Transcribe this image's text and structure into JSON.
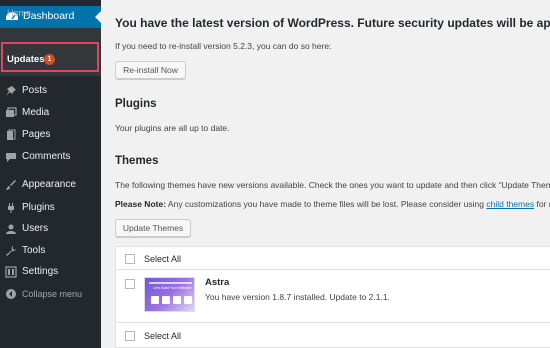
{
  "sidebar": {
    "dashboard_label": "Dashboard",
    "home_label": "Home",
    "updates_label": "Updates",
    "updates_count": "1",
    "items": [
      {
        "label": "Posts",
        "icon": "pin-icon"
      },
      {
        "label": "Media",
        "icon": "media-icon"
      },
      {
        "label": "Pages",
        "icon": "pages-icon"
      },
      {
        "label": "Comments",
        "icon": "comments-icon"
      },
      {
        "label": "Appearance",
        "icon": "brush-icon"
      },
      {
        "label": "Plugins",
        "icon": "plugin-icon"
      },
      {
        "label": "Users",
        "icon": "users-icon"
      },
      {
        "label": "Tools",
        "icon": "wrench-icon"
      },
      {
        "label": "Settings",
        "icon": "settings-icon"
      },
      {
        "label": "Collapse menu",
        "icon": "collapse-icon"
      }
    ]
  },
  "main": {
    "latest_heading": "You have the latest version of WordPress. Future security updates will be applied automatically.",
    "reinstall_text": "If you need to re-install version 5.2.3, you can do so here:",
    "reinstall_button": "Re-install Now",
    "plugins_heading": "Plugins",
    "plugins_text": "Your plugins are all up to date.",
    "themes_heading": "Themes",
    "themes_text": "The following themes have new versions available. Check the ones you want to update and then click “Update Themes”.",
    "note_label": "Please Note:",
    "note_text": " Any customizations you have made to theme files will be lost. Please consider using ",
    "note_link": "child themes",
    "note_tail": " for modifications.",
    "update_button": "Update Themes",
    "select_all_top": "Select All",
    "select_all_bottom": "Select All",
    "theme": {
      "name": "Astra",
      "info": "You have version 1.8.7 installed. Update to 2.1.1.",
      "thumb_text": "Let's Build Your Website!"
    }
  },
  "colors": {
    "sidebar_bg": "#23282d",
    "accent": "#0073aa",
    "highlight_box": "#e0465e",
    "badge": "#d54e21"
  }
}
